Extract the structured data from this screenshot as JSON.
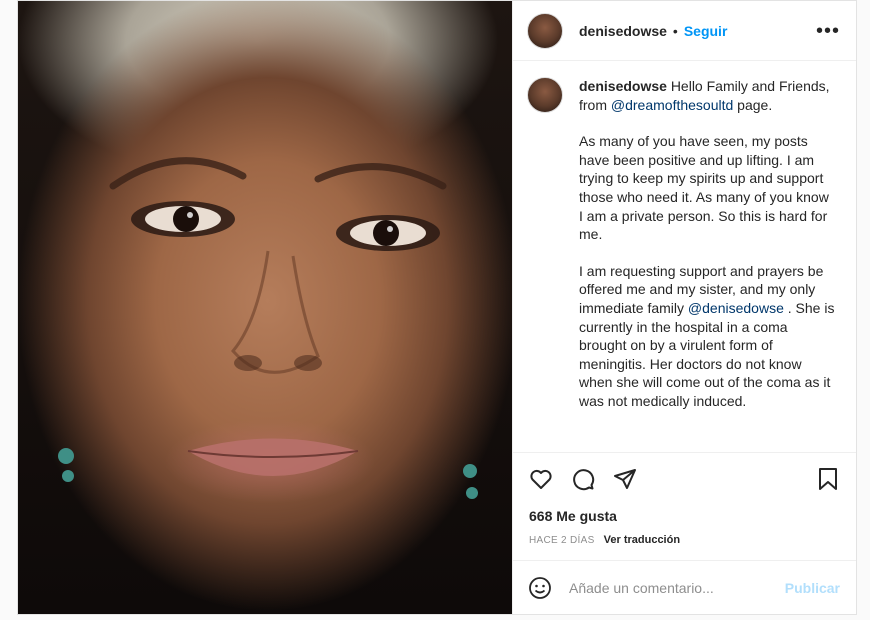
{
  "post": {
    "username": "denisedowse",
    "separator": "•",
    "follow_label": "Seguir",
    "more_label": "•••"
  },
  "caption": {
    "username": "denisedowse",
    "p1_text": "Hello Family and Friends, from ",
    "p1_mention": "@dreamofthesoultd",
    "p1_end": " page.",
    "p2": "As many of you have seen, my posts have been positive and up lifting. I am trying to keep my spirits up and support those who need it. As many of you know I am a private person. So this is hard for me.",
    "p3_text": "I am requesting support and prayers be offered me and my sister, and my only immediate family ",
    "p3_mention": "@denisedowse",
    "p3_end": " . She is currently in the hospital in a coma brought on by a virulent form of meningitis. Her doctors do not know when she will come out of the coma as it was not medically induced."
  },
  "actions": {
    "icons": [
      "heart-icon",
      "comment-icon",
      "share-icon",
      "bookmark-icon"
    ]
  },
  "likes": "668 Me gusta",
  "meta": {
    "time": "HACE 2 DÍAS",
    "translate": "Ver traducción"
  },
  "comment": {
    "placeholder": "Añade un comentario...",
    "publish": "Publicar",
    "emoji_icon": "smiley-icon"
  },
  "colors": {
    "accent": "#0095f6",
    "publish_disabled": "#b2dffc",
    "mention": "#00376b"
  }
}
